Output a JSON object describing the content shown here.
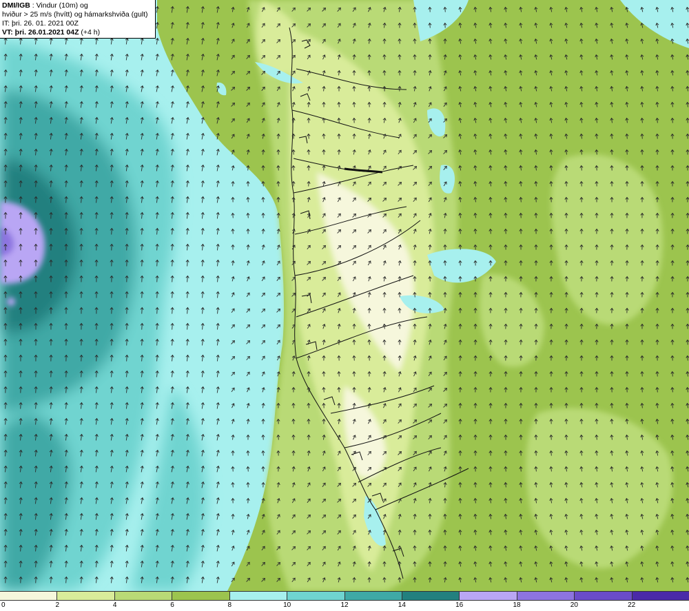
{
  "header": {
    "brand": "DMI/IGB",
    "title_rest": " : Vindur (10m) og",
    "line2": "hviður > 25 m/s (hvítt) og hámarkshviða (gult)",
    "line3": "IT: þri. 26. 01. 2021 00Z",
    "vt_label": "VT: þri. 26.01.2021 04Z",
    "vt_offset": " (+4 h)"
  },
  "legend": {
    "labels": [
      "0",
      "2",
      "4",
      "6",
      "8",
      "10",
      "12",
      "14",
      "16",
      "18",
      "20",
      "22"
    ],
    "colors": [
      "#f6f7dc",
      "#d9ec9a",
      "#b9da76",
      "#9cc44e",
      "#a7f0ee",
      "#6fd4d0",
      "#3fa9a6",
      "#22807f",
      "#b9a6f4",
      "#8d74e0",
      "#6a4cc9",
      "#4a2aa8"
    ]
  },
  "palette": {
    "ocean_near_coast": "#a7f0ee",
    "ocean_mid": "#6fd4d0",
    "ocean_strong": "#3fa9a6",
    "ocean_core": "#22807f",
    "storm_center": "#b9a6f4",
    "land_low_wind": "#9cc44e",
    "land_mid": "#b9da76",
    "land_high": "#d9ec9a",
    "mountains": "#f6f7dc",
    "arrow": "#2a2a2a",
    "coastline": "#111111"
  }
}
